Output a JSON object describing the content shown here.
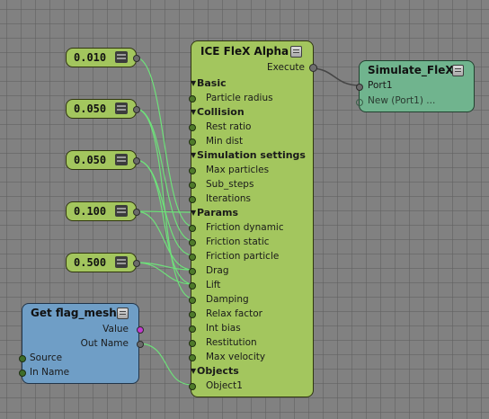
{
  "colors": {
    "canvas_bg": "#818181",
    "value_node": "#a3c65e",
    "ice_node": "#a3c65e",
    "simulate_node": "#70b48e",
    "get_node": "#6f9ec6",
    "wire_green": "#6ee17a",
    "wire_gray": "#454545",
    "value_port": "#c23ad0"
  },
  "scalar_nodes": [
    {
      "value": "0.010"
    },
    {
      "value": "0.050"
    },
    {
      "value": "0.050"
    },
    {
      "value": "0.100"
    },
    {
      "value": "0.500"
    }
  ],
  "ice_node": {
    "title": "ICE FleX Alpha",
    "execute_label": "Execute",
    "rows": [
      {
        "label": "Basic",
        "group": true
      },
      {
        "label": "Particle radius"
      },
      {
        "label": "Collision",
        "group": true
      },
      {
        "label": "Rest ratio"
      },
      {
        "label": "Min dist"
      },
      {
        "label": "Simulation settings",
        "group": true
      },
      {
        "label": "Max particles"
      },
      {
        "label": "Sub_steps"
      },
      {
        "label": "Iterations"
      },
      {
        "label": "Params",
        "group": true
      },
      {
        "label": "Friction dynamic"
      },
      {
        "label": "Friction static"
      },
      {
        "label": "Friction particle"
      },
      {
        "label": "Drag"
      },
      {
        "label": "Lift"
      },
      {
        "label": "Damping"
      },
      {
        "label": "Relax factor"
      },
      {
        "label": "Int bias"
      },
      {
        "label": "Restitution"
      },
      {
        "label": "Max velocity"
      },
      {
        "label": "Objects",
        "group": true
      },
      {
        "label": "Object1"
      }
    ]
  },
  "simulate_node": {
    "title": "Simulate_FleX",
    "port1": "Port1",
    "new_port": "New (Port1) ..."
  },
  "get_node": {
    "title": "Get flag_mesh",
    "outputs": [
      "Value",
      "Out Name"
    ],
    "inputs": [
      "Source",
      "In Name"
    ]
  }
}
